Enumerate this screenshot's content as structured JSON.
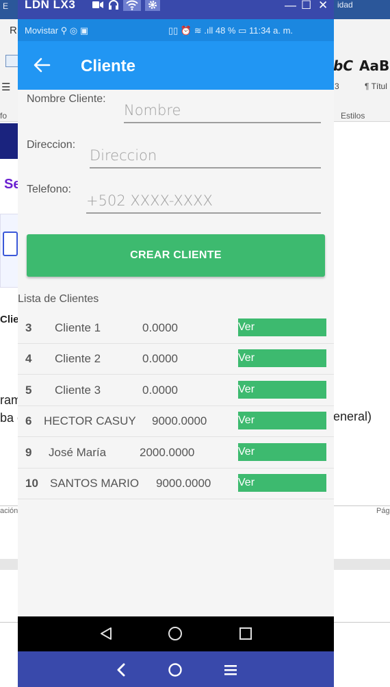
{
  "background_doc": {
    "title_left": "E",
    "title_right": "idad",
    "ribbon_tab": "R",
    "list_icon": "☰",
    "group_left": "fo",
    "style_a": "bC",
    "style_b": "AaBl",
    "style_a_sub": "3",
    "style_b_sub": "¶ Títul",
    "group_right": "Estilos",
    "text_se": "Se",
    "text_clie": "Clie",
    "text_ram": "ram",
    "text_ba": "ba c",
    "text_eneral": "eneral)",
    "footer_left": "ación",
    "footer_right": "Pág"
  },
  "emulator": {
    "title": "LDN LX3",
    "controls": {
      "minimize": "—",
      "maximize": "☐",
      "close": "✕"
    }
  },
  "statusbar": {
    "left": "Movistar ⚲ ◎ ▣",
    "right": "▯▯ ⏰ ≋ .ıll 48 % ▭ 11:34 a. m."
  },
  "appbar": {
    "title": "Cliente"
  },
  "form": {
    "name_label": "Nombre Cliente:",
    "name_placeholder": "Nombre",
    "address_label": "Direccion:",
    "address_placeholder": "Direccion",
    "phone_label": "Telefono:",
    "phone_placeholder": "+502 XXXX-XXXX",
    "create_button": "CREAR CLIENTE"
  },
  "list": {
    "title": "Lista de Clientes",
    "view_label": "Ver",
    "rows": [
      {
        "id": "3",
        "name": "Cliente 1",
        "balance": "0.0000"
      },
      {
        "id": "4",
        "name": "Cliente 2",
        "balance": "0.0000"
      },
      {
        "id": "5",
        "name": "Cliente 3",
        "balance": "0.0000"
      },
      {
        "id": "6",
        "name": "HECTOR CASUY",
        "balance": "9000.0000"
      },
      {
        "id": "9",
        "name": "José María",
        "balance": "2000.0000"
      },
      {
        "id": "10",
        "name": "SANTOS MARIO",
        "balance": "9000.0000"
      }
    ]
  },
  "colors": {
    "primary": "#2196f3",
    "status": "#1b87e0",
    "accent_green": "#3dba6f",
    "emulator_frame": "#3949ab"
  }
}
